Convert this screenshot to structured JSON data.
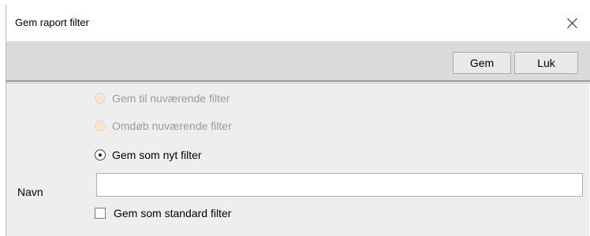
{
  "dialog": {
    "title": "Gem raport filter"
  },
  "toolbar": {
    "save_label": "Gem",
    "close_label": "Luk"
  },
  "options": [
    {
      "label": "Gem til nuværende filter",
      "enabled": false,
      "selected": false
    },
    {
      "label": "Omdøb nuværende filter",
      "enabled": false,
      "selected": false
    },
    {
      "label": "Gem som nyt filter",
      "enabled": true,
      "selected": true
    }
  ],
  "name_field": {
    "label": "Navn",
    "value": ""
  },
  "default_checkbox": {
    "label": "Gem som standard filter",
    "checked": false
  },
  "icons": {
    "close": "close-icon"
  }
}
